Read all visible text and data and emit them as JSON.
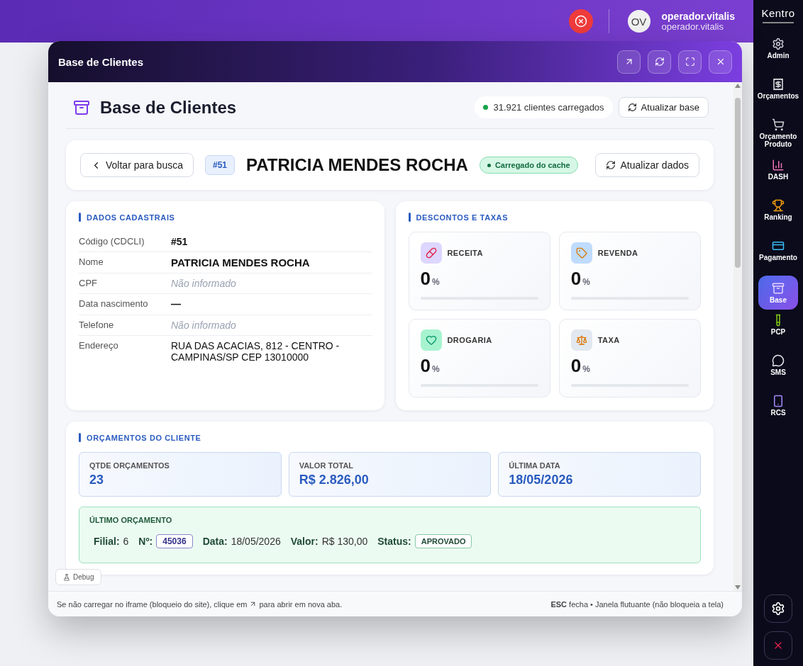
{
  "topbar": {
    "avatar": "OV",
    "user_name": "operador.vitalis",
    "user_sub": "operador.vitalis"
  },
  "sidebar": {
    "logo": "Kentro",
    "items": [
      {
        "label": "Admin",
        "kind": "gear",
        "selected": false
      },
      {
        "label": "Orçamentos",
        "kind": "receipt",
        "selected": false
      },
      {
        "label": "Orçamento Produto",
        "kind": "cart",
        "selected": false
      },
      {
        "label": "DASH",
        "kind": "chart",
        "selected": false
      },
      {
        "label": "Ranking",
        "kind": "trophy",
        "selected": false
      },
      {
        "label": "Pagamento",
        "kind": "card",
        "selected": false
      },
      {
        "label": "Base",
        "kind": "base",
        "selected": true
      },
      {
        "label": "PCP",
        "kind": "tube",
        "selected": false
      },
      {
        "label": "SMS",
        "kind": "bubble",
        "selected": false
      },
      {
        "label": "RCS",
        "kind": "phone",
        "selected": false
      }
    ]
  },
  "window": {
    "title": "Base de Clientes"
  },
  "page": {
    "title": "Base de Clientes",
    "count": "31.921 clientes carregados",
    "refresh": "Atualizar base"
  },
  "client": {
    "back": "Voltar para busca",
    "code": "#51",
    "name": "PATRICIA MENDES ROCHA",
    "badge": "Carregado do cache",
    "refresh": "Atualizar dados"
  },
  "dados": {
    "title": "DADOS CADASTRAIS",
    "rows": [
      {
        "label": "Código (CDCLI)",
        "value": "#51",
        "kind": "code"
      },
      {
        "label": "Nome",
        "value": "PATRICIA MENDES ROCHA",
        "kind": "name"
      },
      {
        "label": "CPF",
        "value": "Não informado",
        "kind": "missing"
      },
      {
        "label": "Data nascimento",
        "value": "—",
        "kind": "code"
      },
      {
        "label": "Telefone",
        "value": "Não informado",
        "kind": "missing"
      },
      {
        "label": "Endereço",
        "value": "RUA DAS ACACIAS, 812 - CENTRO - CAMPINAS/SP CEP 13010000",
        "kind": "plain"
      }
    ]
  },
  "descontos": {
    "title": "DESCONTOS E TAXAS",
    "items": [
      {
        "label": "RECEITA",
        "value": "0",
        "unit": "%",
        "level": 0,
        "kind": "pill",
        "color": "#ddd6fe"
      },
      {
        "label": "REVENDA",
        "value": "0",
        "unit": "%",
        "level": 0,
        "kind": "tag",
        "color": "#bfdbfe"
      },
      {
        "label": "DROGARIA",
        "value": "0",
        "unit": "%",
        "level": 0,
        "kind": "heart",
        "color": "#a7f3d0"
      },
      {
        "label": "TAXA",
        "value": "0",
        "unit": "%",
        "level": 0,
        "kind": "scale",
        "color": "#e2e8f0"
      }
    ]
  },
  "orcamentos": {
    "title": "ORÇAMENTOS DO CLIENTE",
    "stats": [
      {
        "label": "QTDE ORÇAMENTOS",
        "value": "23"
      },
      {
        "label": "VALOR TOTAL",
        "value": "R$ 2.826,00"
      },
      {
        "label": "ÚLTIMA DATA",
        "value": "18/05/2026"
      }
    ],
    "last": {
      "title": "ÚLTIMO ORÇAMENTO",
      "fields": [
        {
          "label": "Filial:",
          "value": "6",
          "kind": "text"
        },
        {
          "label": "Nº:",
          "value": "45036",
          "kind": "number"
        },
        {
          "label": "Data:",
          "value": "18/05/2026",
          "kind": "text"
        },
        {
          "label": "Valor:",
          "value": "R$ 130,00",
          "kind": "text"
        },
        {
          "label": "Status:",
          "value": "APROVADO",
          "kind": "status"
        }
      ]
    }
  },
  "debug": "Debug",
  "footer": {
    "left_a": "Se não carregar no iframe (bloqueio do site), clique em",
    "left_b": "para abrir em nova aba.",
    "right": "**ESC** fecha • Janela flutuante (não bloqueia a tela)"
  }
}
